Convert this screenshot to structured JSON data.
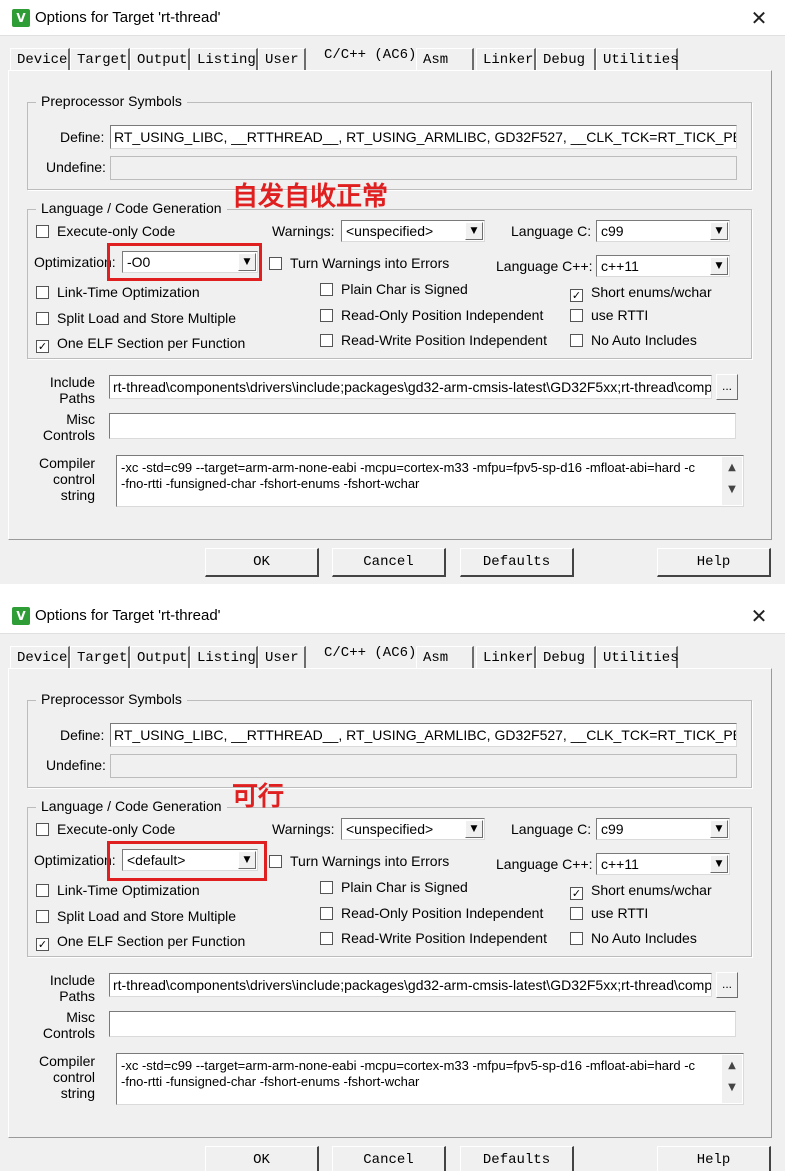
{
  "dialogs": [
    {
      "title": "Options for Target 'rt-thread'",
      "tabs": [
        "Device",
        "Target",
        "Output",
        "Listing",
        "User",
        "C/C++ (AC6)",
        "Asm",
        "Linker",
        "Debug",
        "Utilities"
      ],
      "active_tab": "C/C++ (AC6)",
      "preprocessor": {
        "group_label": "Preprocessor Symbols",
        "define_label": "Define:",
        "define_value": "RT_USING_LIBC, __RTTHREAD__, RT_USING_ARMLIBC, GD32F527, __CLK_TCK=RT_TICK_PER_",
        "undefine_label": "Undefine:",
        "undefine_value": ""
      },
      "codegen": {
        "group_label": "Language / Code Generation",
        "execute_only": "Execute-only Code",
        "optimization_label": "Optimization:",
        "optimization_value": "-O0",
        "link_time": "Link-Time Optimization",
        "split_load": "Split Load and Store Multiple",
        "one_elf": "One ELF Section per Function",
        "warnings_label": "Warnings:",
        "warnings_value": "<unspecified>",
        "turn_warnings": "Turn Warnings into Errors",
        "plain_char": "Plain Char is Signed",
        "ropi": "Read-Only Position Independent",
        "rwpi": "Read-Write Position Independent",
        "language_c_label": "Language C:",
        "language_c_value": "c99",
        "language_cpp_label": "Language C++:",
        "language_cpp_value": "c++11",
        "short_enums": "Short enums/wchar",
        "use_rtti": "use RTTI",
        "no_auto_includes": "No Auto Includes"
      },
      "include_label": "Include\nPaths",
      "include_value": "rt-thread\\components\\drivers\\include;packages\\gd32-arm-cmsis-latest\\GD32F5xx;rt-thread\\compone",
      "misc_label": "Misc\nControls",
      "misc_value": "",
      "compiler_label": "Compiler\ncontrol\nstring",
      "compiler_value": "-xc -std=c99 --target=arm-arm-none-eabi -mcpu=cortex-m33 -mfpu=fpv5-sp-d16 -mfloat-abi=hard -c\n-fno-rtti -funsigned-char -fshort-enums -fshort-wchar",
      "buttons": {
        "ok": "OK",
        "cancel": "Cancel",
        "defaults": "Defaults",
        "help": "Help"
      },
      "annotation": "自发自收正常"
    },
    {
      "title": "Options for Target 'rt-thread'",
      "tabs": [
        "Device",
        "Target",
        "Output",
        "Listing",
        "User",
        "C/C++ (AC6)",
        "Asm",
        "Linker",
        "Debug",
        "Utilities"
      ],
      "active_tab": "C/C++ (AC6)",
      "preprocessor": {
        "group_label": "Preprocessor Symbols",
        "define_label": "Define:",
        "define_value": "RT_USING_LIBC, __RTTHREAD__, RT_USING_ARMLIBC, GD32F527, __CLK_TCK=RT_TICK_PER_",
        "undefine_label": "Undefine:",
        "undefine_value": ""
      },
      "codegen": {
        "group_label": "Language / Code Generation",
        "execute_only": "Execute-only Code",
        "optimization_label": "Optimization:",
        "optimization_value": "<default>",
        "link_time": "Link-Time Optimization",
        "split_load": "Split Load and Store Multiple",
        "one_elf": "One ELF Section per Function",
        "warnings_label": "Warnings:",
        "warnings_value": "<unspecified>",
        "turn_warnings": "Turn Warnings into Errors",
        "plain_char": "Plain Char is Signed",
        "ropi": "Read-Only Position Independent",
        "rwpi": "Read-Write Position Independent",
        "language_c_label": "Language C:",
        "language_c_value": "c99",
        "language_cpp_label": "Language C++:",
        "language_cpp_value": "c++11",
        "short_enums": "Short enums/wchar",
        "use_rtti": "use RTTI",
        "no_auto_includes": "No Auto Includes"
      },
      "include_label": "Include\nPaths",
      "include_value": "rt-thread\\components\\drivers\\include;packages\\gd32-arm-cmsis-latest\\GD32F5xx;rt-thread\\compone",
      "misc_label": "Misc\nControls",
      "misc_value": "",
      "compiler_label": "Compiler\ncontrol\nstring",
      "compiler_value": "-xc -std=c99 --target=arm-arm-none-eabi -mcpu=cortex-m33 -mfpu=fpv5-sp-d16 -mfloat-abi=hard -c\n-fno-rtti -funsigned-char -fshort-enums -fshort-wchar",
      "buttons": {
        "ok": "OK",
        "cancel": "Cancel",
        "defaults": "Defaults",
        "help": "Help"
      },
      "annotation": "可行"
    }
  ],
  "checkbox_states": {
    "execute_only": false,
    "link_time": false,
    "split_load": false,
    "one_elf": true,
    "turn_warnings": false,
    "plain_char": false,
    "ropi": false,
    "rwpi": false,
    "short_enums": true,
    "use_rtti": false,
    "no_auto_includes": false
  },
  "icons": {
    "app": "keil-uvision-icon",
    "close": "close-icon",
    "dropdown": "chevron-down-icon"
  },
  "colors": {
    "highlight": "#e02020",
    "dialog_bg": "#f0f0f0"
  }
}
